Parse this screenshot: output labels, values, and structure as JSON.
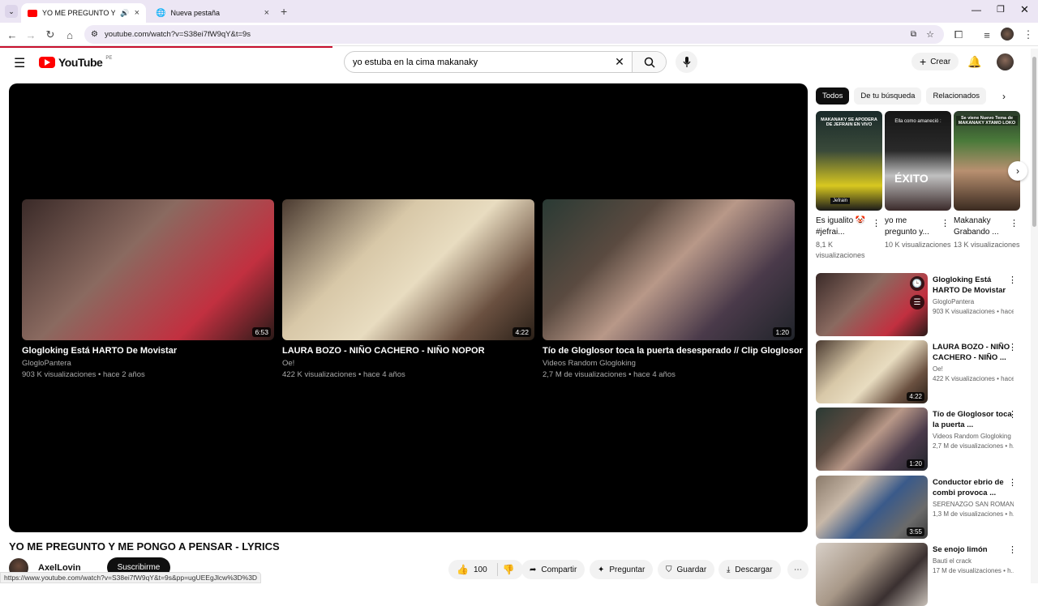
{
  "browser": {
    "tabs": [
      {
        "title": "YO ME PREGUNTO Y ME PO"
      },
      {
        "title": "Nueva pestaña"
      }
    ],
    "url": "youtube.com/watch?v=S38ei7fW9qY&t=9s",
    "status_url": "https://www.youtube.com/watch?v=S38ei7fW9qY&t=9s&pp=ugUEEgJlcw%3D%3D"
  },
  "header": {
    "logo_text": "YouTube",
    "region": "PE",
    "search_value": "yo estuba en la cima makanaky",
    "create_label": "Crear"
  },
  "endscreen": [
    {
      "title": "Glogloking Está HARTO De Movistar",
      "channel": "GlogloPantera",
      "meta": "903 K visualizaciones • hace 2 años",
      "duration": "6:53"
    },
    {
      "title": "LAURA BOZO - NIÑO CACHERO - NIÑO NOPOR",
      "channel": "Oe!",
      "meta": "422 K visualizaciones • hace 4 años",
      "duration": "4:22"
    },
    {
      "title": "Tío de Gloglosor toca la puerta desesperado // Clip Gloglosor",
      "channel": "Videos Random Glogloking",
      "meta": "2,7 M de visualizaciones • hace 4 años",
      "duration": "1:20"
    }
  ],
  "video": {
    "title": "YO ME PREGUNTO Y ME PONGO A PENSAR - LYRICS",
    "channel": "AxelLovin",
    "subscribe_label": "Suscribirme",
    "likes": "100",
    "share_label": "Compartir",
    "ask_label": "Preguntar",
    "save_label": "Guardar",
    "download_label": "Descargar"
  },
  "chips": [
    "Todos",
    "De tu búsqueda",
    "Relacionados"
  ],
  "shorts": [
    {
      "title": "Es igualito 🤡 #jefrai...",
      "views": "8,1 K visualizaciones",
      "thumb_text": "MAKANAKY SE APODERA DE JEFRAIN EN VIVO",
      "thumb_tag": "Jefrain"
    },
    {
      "title": "yo me pregunto y...",
      "views": "10 K visualizaciones",
      "thumb_text": "Ella como amaneció :",
      "thumb_tag": "ÉXITO"
    },
    {
      "title": "Makanaky Grabando ...",
      "views": "13 K visualizaciones",
      "thumb_text": "Se viene Nuevo Tema de MAKANAKY XTAMO LOKO"
    }
  ],
  "recommended": [
    {
      "title": "Glogloking Está HARTO De Movistar",
      "channel": "GlogloPantera",
      "meta": "903 K visualizaciones • hace...",
      "duration": ""
    },
    {
      "title": "LAURA BOZO - NIÑO CACHERO - NIÑO ...",
      "channel": "Oe!",
      "meta": "422 K visualizaciones • hace...",
      "duration": "4:22"
    },
    {
      "title": "Tío de Gloglosor toca la puerta ...",
      "channel": "Videos Random Glogloking",
      "meta": "2,7 M de visualizaciones • h...",
      "duration": "1:20"
    },
    {
      "title": "Conductor ebrio de combi provoca ...",
      "channel": "SERENAZGO SAN ROMAN O...",
      "meta": "1,3 M de visualizaciones • h...",
      "duration": "3:55"
    },
    {
      "title": "Se enojo limón",
      "channel": "Bauti el crack",
      "meta": "17 M de visualizaciones • h...",
      "duration": ""
    }
  ]
}
